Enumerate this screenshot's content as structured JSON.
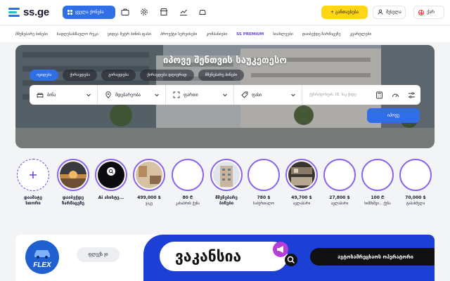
{
  "header": {
    "logo_text": "ss.ge",
    "category_button": "ყველა ქონება",
    "add_listing": "+ განთავსება",
    "login": "შესვლა",
    "language": "ქარ"
  },
  "subnav": {
    "items": [
      "მშენებარე ბინები",
      "სადღესასწაულო რუკა",
      "ყიდვა მეტრ ბინის ფასი",
      "პროექტი სერვისები",
      "კომპანიები",
      "SS PREMIUM",
      "სიახლეები",
      "დაიბეჭდე ზარმაცეზე",
      "კვარტლები"
    ]
  },
  "hero": {
    "title": "იპოვე შენთვის საუკეთესო",
    "tabs": [
      "იყიდება",
      "ქირავდება",
      "გირავდება",
      "ქირავდება დღიურად",
      "მშენებარე ბინები"
    ],
    "search": {
      "type": "ბინა",
      "location": "მდებარეობა",
      "area": "ფართი",
      "price": "ფასი",
      "placeholder": "ქუჩის/ფოსტის, ID, ნაკ ჭიდე",
      "button": "იპოვე"
    }
  },
  "stories": [
    {
      "title": "დაამატე",
      "subtitle": "სთორი",
      "kind": "add"
    },
    {
      "title": "დაიბეჭდე",
      "subtitle": "ზარმაცეზე",
      "kind": "sunset"
    },
    {
      "title": "Ai ასისტე...",
      "subtitle": "",
      "kind": "ai"
    },
    {
      "title": "499,000 $",
      "subtitle": "ვაკე",
      "kind": "interior"
    },
    {
      "title": "80 ₾",
      "subtitle": "კახაბრის ქუჩა",
      "kind": "blank"
    },
    {
      "title": "მშენებარე",
      "subtitle": "ბინები",
      "kind": "building"
    },
    {
      "title": "780 $",
      "subtitle": "საბურთალო",
      "kind": "blank"
    },
    {
      "title": "49,700 $",
      "subtitle": "ავლაბარი",
      "kind": "kitchen"
    },
    {
      "title": "27,800 $",
      "subtitle": "ავლაბარი",
      "kind": "blank"
    },
    {
      "title": "100 ₾",
      "subtitle": "ხიშმიშვი... ქუჩა",
      "kind": "blank"
    },
    {
      "title": "70,000 $",
      "subtitle": "ტაბახმელა",
      "kind": "blank"
    }
  ],
  "banner": {
    "logo_text": "FLEX",
    "button": "ფლექს ჯი",
    "headline": "ვაკანსია",
    "role": "ავტოსამრეცხაოს ოპერატორი"
  },
  "colors": {
    "primary": "#2f6ee6",
    "accent_yellow": "#fed613",
    "story_ring": "#8a63f0",
    "banner_blue": "#1c3fd6"
  }
}
